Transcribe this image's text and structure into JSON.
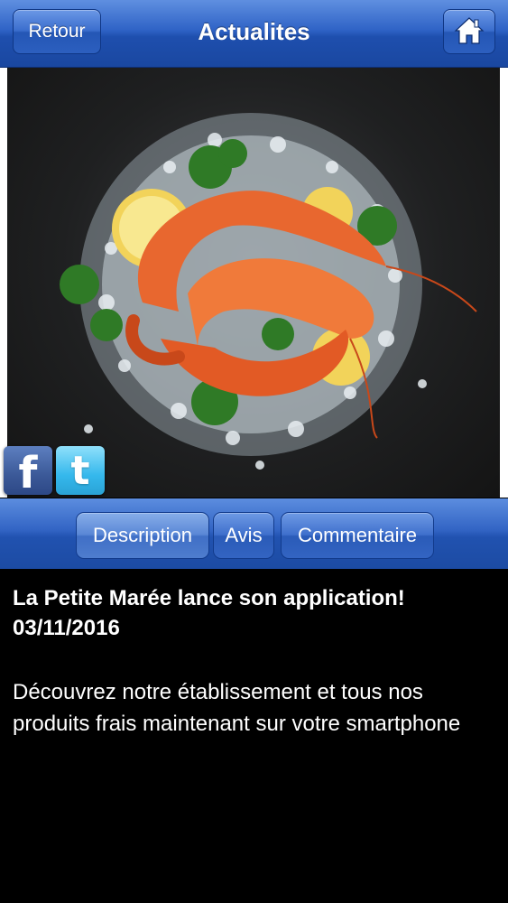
{
  "header": {
    "back_label": "Retour",
    "title": "Actualites",
    "home_icon": "home-icon"
  },
  "hero": {
    "icons": [
      "facebook-icon",
      "twitter-icon"
    ],
    "facebook_glyph": "f",
    "twitter_glyph": "t"
  },
  "tabs": [
    {
      "label": "Description",
      "selected": true
    },
    {
      "label": "Avis",
      "selected": false
    },
    {
      "label": "Commentaire",
      "selected": false
    }
  ],
  "article": {
    "title": "La Petite Marée lance son application!",
    "date": "03/11/2016",
    "body": "Découvrez notre établissement et tous nos produits frais maintenant sur votre smartphone"
  },
  "colors": {
    "bar_blue": "#2f63c6",
    "background": "#000000",
    "text": "#ffffff"
  }
}
